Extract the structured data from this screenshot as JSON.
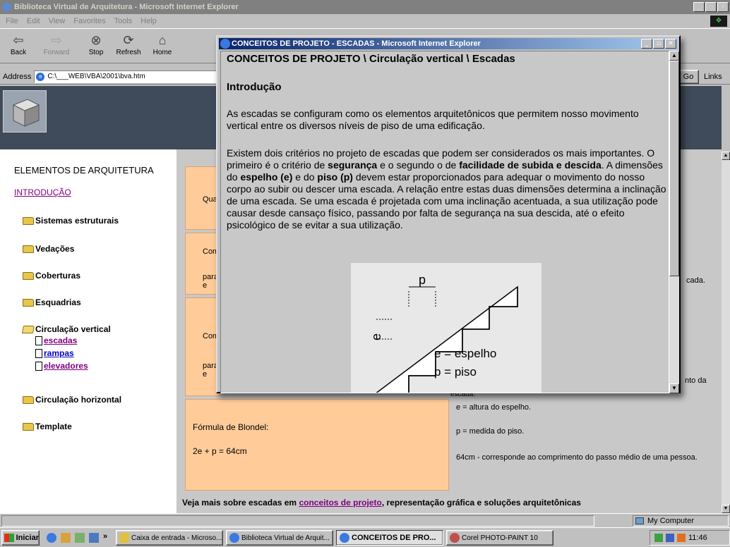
{
  "main_window": {
    "title": "Biblioteca Virtual de Arquitetura - Microsoft Internet Explorer",
    "menu": [
      "File",
      "Edit",
      "View",
      "Favorites",
      "Tools",
      "Help"
    ],
    "toolbar": {
      "back": "Back",
      "forward": "Forward",
      "stop": "Stop",
      "refresh": "Refresh",
      "home": "Home"
    },
    "address_label": "Address",
    "address_value": "C:\\___WEB\\VBA\\2001\\bva.htm",
    "go_label": "Go",
    "links_label": "Links"
  },
  "sidebar": {
    "heading": "ELEMENTOS DE ARQUITETURA",
    "intro_link": "INTRODUÇÃO",
    "items": [
      "Sistemas estruturais",
      "Vedações",
      "Coberturas",
      "Esquadrias",
      "Circulação vertical",
      "Circulação horizontal",
      "Template"
    ],
    "subitems": [
      "escadas",
      "rampas",
      "elevadores"
    ]
  },
  "content": {
    "cells": {
      "c1": "Quant",
      "c2a": "Comp",
      "c2b": "para e",
      "c2r": "cada.",
      "c3a": "Comp",
      "c3b": "para e",
      "c3r": "nto da",
      "c3r2": "escada.",
      "blondel_label": "Fórmula de Blondel:",
      "blondel_formula": "2e + p = 64cm",
      "e_def": "e = altura do espelho.",
      "p_def": "p = medida do piso.",
      "cm_def": "64cm - corresponde ao comprimento do passo médio de uma pessoa."
    },
    "bottom": {
      "prefix": "Veja mais sobre escadas em ",
      "link": "conceitos de projeto",
      "suffix": ", representação gráfica e soluções arquitetônicas"
    }
  },
  "status": {
    "zone": "My Computer"
  },
  "taskbar": {
    "start": "Iniciar",
    "more": "»",
    "tasks": [
      "Caixa de entrada - Microso...",
      "Biblioteca Virtual de Arquit...",
      "CONCEITOS DE PRO...",
      "Corel PHOTO-PAINT 10"
    ],
    "clock": "11:46"
  },
  "popup": {
    "title": "CONCEITOS DE PROJETO - ESCADAS - Microsoft Internet Explorer",
    "heading": "CONCEITOS DE PROJETO \\ Circulação vertical \\ Escadas",
    "intro_title": "Introdução",
    "para1": "As escadas se configuram como os elementos arquitetônicos que permitem nosso movimento vertical entre os diversos níveis de piso de uma edificação.",
    "para2": {
      "t1": "Existem dois critérios no projeto de escadas que podem ser considerados os mais importantes. O primeiro é o critério de ",
      "b1": "segurança",
      "t2": " e o segundo o de ",
      "b2": "facilidade de subida e descida",
      "t3": ". A dimensões do ",
      "b3": "espelho (e)",
      "t4": " e do ",
      "b4": "piso (p)",
      "t5": " devem estar proporcionados para adequar o movimento do nosso corpo ao subir ou descer uma escada. A relação entre estas duas dimensões determina a inclinação de uma escada. Se uma escada é projetada com uma inclinação acentuada, a sua utilização pode causar desde cansaço físico, passando por falta de segurança na sua descida, até o efeito psicológico de se evitar a sua utilização."
    },
    "figure": {
      "p_label": "p",
      "e_label": "e",
      "legend_e": "e = espelho",
      "legend_p": "p = piso"
    }
  }
}
